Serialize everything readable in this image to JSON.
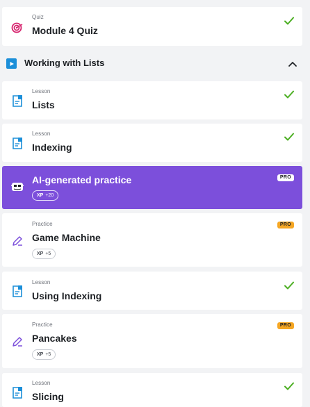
{
  "colors": {
    "accent_purple": "#7c4fdb",
    "check_green": "#4caf23",
    "pro_orange": "#f5a623",
    "lesson_blue": "#1c8fd9",
    "quiz_pink": "#d6246e"
  },
  "section": {
    "title": "Working with Lists",
    "icon": "play-icon",
    "toggle_icon": "chevron-up-icon"
  },
  "items": [
    {
      "type": "Quiz",
      "title": "Module 4 Quiz",
      "icon": "target-icon",
      "completed": true
    },
    {
      "type": "Lesson",
      "title": "Lists",
      "icon": "document-icon",
      "completed": true
    },
    {
      "type": "Lesson",
      "title": "Indexing",
      "icon": "document-icon",
      "completed": true
    },
    {
      "type": "",
      "title": "AI-generated practice",
      "icon": "robot-face-icon",
      "badge": "PRO",
      "xp_label": "XP",
      "xp_value": "+20",
      "active": true
    },
    {
      "type": "Practice",
      "title": "Game Machine",
      "icon": "pencil-icon",
      "badge": "PRO",
      "xp_label": "XP",
      "xp_value": "+5"
    },
    {
      "type": "Lesson",
      "title": "Using Indexing",
      "icon": "document-icon",
      "completed": true
    },
    {
      "type": "Practice",
      "title": "Pancakes",
      "icon": "pencil-icon",
      "badge": "PRO",
      "xp_label": "XP",
      "xp_value": "+5"
    },
    {
      "type": "Lesson",
      "title": "Slicing",
      "icon": "document-icon",
      "completed": true
    }
  ]
}
